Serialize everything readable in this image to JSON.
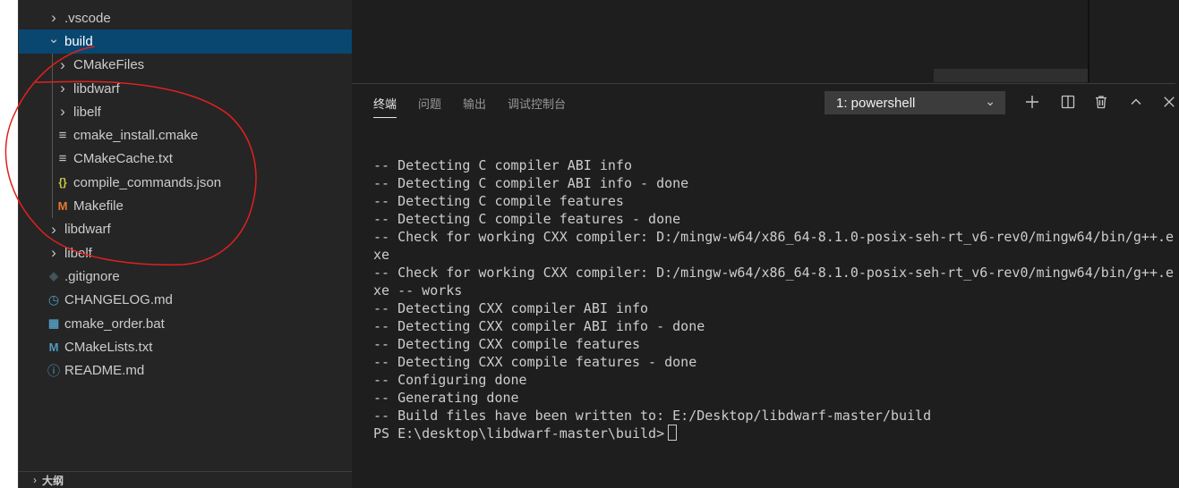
{
  "explorer": {
    "items": [
      {
        "label": ".vscode",
        "kind": "folder",
        "expanded": false,
        "depth": 0,
        "icon": "chevron-right-icon"
      },
      {
        "label": "build",
        "kind": "folder",
        "expanded": true,
        "depth": 0,
        "icon": "chevron-down-icon",
        "selected": true
      },
      {
        "label": "CMakeFiles",
        "kind": "folder",
        "expanded": false,
        "depth": 1,
        "icon": "chevron-right-icon"
      },
      {
        "label": "libdwarf",
        "kind": "folder",
        "expanded": false,
        "depth": 1,
        "icon": "chevron-right-icon"
      },
      {
        "label": "libelf",
        "kind": "folder",
        "expanded": false,
        "depth": 1,
        "icon": "chevron-right-icon"
      },
      {
        "label": "cmake_install.cmake",
        "kind": "file",
        "depth": 1,
        "icon": "text-lines-icon",
        "glyph": "≡",
        "color": "#c5c5c5"
      },
      {
        "label": "CMakeCache.txt",
        "kind": "file",
        "depth": 1,
        "icon": "text-lines-icon",
        "glyph": "≡",
        "color": "#c5c5c5"
      },
      {
        "label": "compile_commands.json",
        "kind": "file",
        "depth": 1,
        "icon": "json-braces-icon",
        "glyph": "{}",
        "color": "#cbcb41"
      },
      {
        "label": "Makefile",
        "kind": "file",
        "depth": 1,
        "icon": "makefile-m-icon",
        "glyph": "M",
        "color": "#e37933"
      },
      {
        "label": "libdwarf",
        "kind": "folder",
        "expanded": false,
        "depth": 0,
        "icon": "chevron-right-icon"
      },
      {
        "label": "libelf",
        "kind": "folder",
        "expanded": false,
        "depth": 0,
        "icon": "chevron-right-icon"
      },
      {
        "label": ".gitignore",
        "kind": "file",
        "depth": 0,
        "icon": "git-diamond-icon",
        "glyph": "◆",
        "color": "#41535b"
      },
      {
        "label": "CHANGELOG.md",
        "kind": "file",
        "depth": 0,
        "icon": "clock-icon",
        "glyph": "◷",
        "color": "#519aba"
      },
      {
        "label": "cmake_order.bat",
        "kind": "file",
        "depth": 0,
        "icon": "windows-icon",
        "glyph": "▦",
        "color": "#519aba"
      },
      {
        "label": "CMakeLists.txt",
        "kind": "file",
        "depth": 0,
        "icon": "markdown-m-icon",
        "glyph": "M",
        "color": "#519aba"
      },
      {
        "label": "README.md",
        "kind": "file",
        "depth": 0,
        "icon": "info-icon",
        "glyph": "ⓘ",
        "color": "#519aba"
      }
    ],
    "outline_label": "大纲"
  },
  "panel": {
    "tabs": [
      {
        "label": "终端",
        "active": true
      },
      {
        "label": "问题",
        "active": false
      },
      {
        "label": "输出",
        "active": false
      },
      {
        "label": "调试控制台",
        "active": false
      }
    ],
    "terminal_select": "1: powershell",
    "tools": [
      {
        "name": "new-terminal-plus-icon",
        "glyph": "+"
      },
      {
        "name": "split-terminal-icon",
        "glyph": "◫"
      },
      {
        "name": "trash-icon",
        "glyph": "🗑"
      },
      {
        "name": "maximize-chevron-up-icon",
        "glyph": "⌃"
      },
      {
        "name": "close-icon",
        "glyph": "✕"
      }
    ]
  },
  "terminal": {
    "lines": [
      "-- Detecting C compiler ABI info",
      "-- Detecting C compiler ABI info - done",
      "-- Detecting C compile features",
      "-- Detecting C compile features - done",
      "-- Check for working CXX compiler: D:/mingw-w64/x86_64-8.1.0-posix-seh-rt_v6-rev0/mingw64/bin/g++.e",
      "xe",
      "-- Check for working CXX compiler: D:/mingw-w64/x86_64-8.1.0-posix-seh-rt_v6-rev0/mingw64/bin/g++.e",
      "xe -- works",
      "-- Detecting CXX compiler ABI info",
      "-- Detecting CXX compiler ABI info - done",
      "-- Detecting CXX compile features",
      "-- Detecting CXX compile features - done",
      "-- Configuring done",
      "-- Generating done",
      "-- Build files have been written to: E:/Desktop/libdwarf-master/build"
    ],
    "prompt": "PS E:\\desktop\\libdwarf-master\\build>"
  },
  "annotation_color": "#e0211d"
}
